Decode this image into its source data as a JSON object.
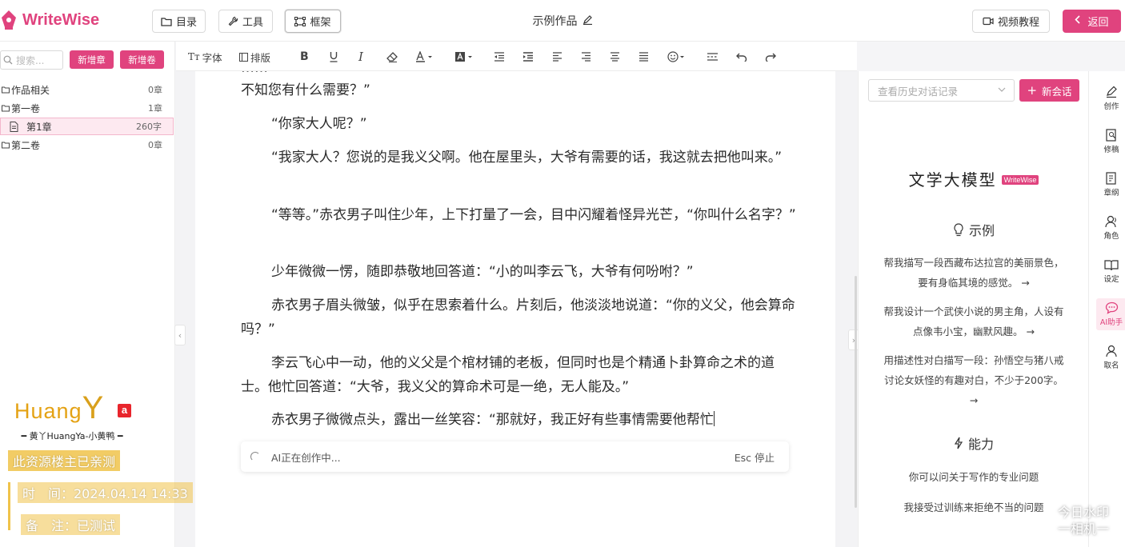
{
  "app": {
    "name": "WriteWise",
    "brand_color": "#e0437e"
  },
  "header": {
    "catalog_label": "目录",
    "tools_label": "工具",
    "frame_label": "框架",
    "doc_title": "示例作品",
    "tutorial_label": "视频教程",
    "back_label": "返回"
  },
  "sidebar": {
    "search_placeholder": "搜索...",
    "new_chapter_label": "新增章",
    "new_volume_label": "新增卷",
    "tree": [
      {
        "label": "作品相关",
        "count": "0章"
      },
      {
        "label": "第一卷",
        "count": "1章"
      },
      {
        "label": "第1章",
        "count": "260字",
        "selected": true
      },
      {
        "label": "第二卷",
        "count": "0章"
      }
    ]
  },
  "toolbar": {
    "font_label": "字体",
    "layout_label": "排版",
    "font_prefix": "Tт",
    "buttons": [
      "bold-icon",
      "underline-icon",
      "italic-icon",
      "eraser-icon",
      "font-color-icon",
      "highlight-icon",
      "outdent-icon",
      "indent-icon",
      "align-left-icon",
      "align-right-icon",
      "align-center-icon",
      "justify-icon",
      "emoji-icon",
      "divider-icon",
      "undo-icon",
      "redo-icon"
    ]
  },
  "editor": {
    "partial_line": "不知您有什么需要？”",
    "paragraphs": [
      "“你家大人呢？”",
      "“我家大人？您说的是我义父啊。他在屋里头，大爷有需要的话，我这就去把他叫来。”",
      "“等等。”赤衣男子叫住少年，上下打量了一会，目中闪耀着怪异光芒，“你叫什么名字？”",
      "少年微微一愣，随即恭敬地回答道：“小的叫李云飞，大爷有何吩咐？”",
      "赤衣男子眉头微皱，似乎在思索着什么。片刻后，他淡淡地说道：“你的义父，他会算命吗？”",
      "李云飞心中一动，他的义父是个棺材铺的老板，但同时也是个精通卜卦算命之术的道士。他忙回答道：“大爷，我义父的算命术可是一绝，无人能及。”",
      "赤衣男子微微点头，露出一丝笑容：“那就好，我正好有些事情需要他帮忙"
    ],
    "ai_status": "AI正在创作中...",
    "ai_stop": "Esc 停止"
  },
  "assistant": {
    "history_placeholder": "查看历史对话记录",
    "new_chat_label": "新会话",
    "model_title": "文学大模型",
    "model_badge": "WriteWise",
    "examples_title": "示例",
    "examples": [
      "帮我描写一段西藏布达拉宫的美丽景色，要有身临其境的感觉。",
      "帮我设计一个武侠小说的男主角，人设有点像韦小宝，幽默风趣。",
      "用描述性对白描写一段：孙悟空与猪八戒讨论女妖怪的有趣对白，不少于200字。"
    ],
    "abilities_title": "能力",
    "abilities": [
      "你可以问关于写作的专业问题",
      "我接受过训练来拒绝不当的问题"
    ]
  },
  "rail": [
    {
      "label": "创作",
      "icon": "create-icon"
    },
    {
      "label": "修稿",
      "icon": "revise-icon"
    },
    {
      "label": "章纲",
      "icon": "outline-icon"
    },
    {
      "label": "角色",
      "icon": "character-icon"
    },
    {
      "label": "设定",
      "icon": "settings-book-icon"
    },
    {
      "label": "AI助手",
      "icon": "ai-chat-icon",
      "active": true
    },
    {
      "label": "取名",
      "icon": "naming-icon"
    }
  ],
  "watermark": {
    "logo_huang": "Huang",
    "logo_y": "Y",
    "logo_a": "a",
    "logo_sub": "黄丫HuangYa-小黄鸭",
    "line1": "此资源楼主已亲测",
    "line2": "时　间：2024.04.14 14:33",
    "line3": "备　注：已测试",
    "corner1": "今日水印",
    "corner2": "一相机一"
  }
}
